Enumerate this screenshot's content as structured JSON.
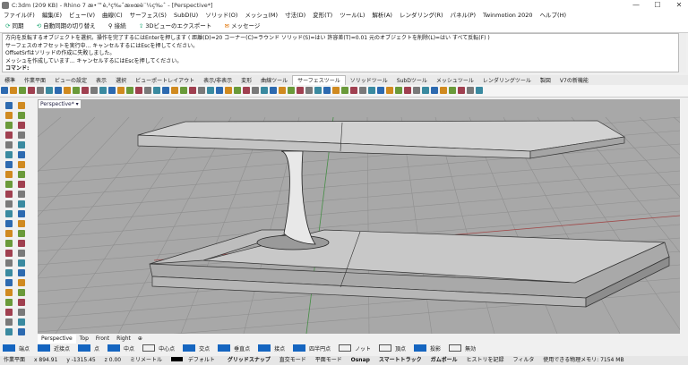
{
  "titlebar": {
    "title": "C:3dm (209 KB) - Rhino 7 æ•™è‚²ç‰ˆæ¤œè¨¼ç‰ˆ - [Perspective*]",
    "minimize": "—",
    "maximize": "☐",
    "close": "✕"
  },
  "menu": [
    "ファイル(F)",
    "編集(E)",
    "ビュー(V)",
    "曲線(C)",
    "サーフェス(S)",
    "SubD(U)",
    "ソリッド(O)",
    "メッシュ(M)",
    "寸法(D)",
    "変形(T)",
    "ツール(L)",
    "解析(A)",
    "レンダリング(R)",
    "パネル(P)",
    "Twinmotion 2020",
    "ヘルプ(H)"
  ],
  "commandbar": [
    {
      "icon": "sync-icon",
      "label": "同期"
    },
    {
      "icon": "auto-sync-icon",
      "label": "自動同期の切り替え"
    },
    {
      "icon": "link-icon",
      "label": "接続"
    },
    {
      "icon": "export-icon",
      "label": "3Dビューのエクスポート"
    },
    {
      "icon": "message-icon",
      "label": "メッセージ"
    }
  ],
  "history": [
    "方向を反転するオブジェクトを選択。操作を完了するにはEnterを押します ( 距離(D)=20  コーナー(C)=ラウンド  ソリッド(S)=はい  許容差(T)=0.01  元のオブジェクトを削除(L)=はい  すべて反転(F) )",
    "サーフェスのオフセットを実行中... キャンセルするにはEscを押してください。",
    "OffsetSrfはソリッドの作成に失敗しました。",
    "メッシュを作成しています... キャンセルするにはEscを押してください。",
    "コマンド:"
  ],
  "tabs": [
    "標準",
    "作業平面",
    "ビューの設定",
    "表示",
    "選択",
    "ビューポートレイアウト",
    "表示/非表示",
    "変形",
    "曲線ツール",
    "サーフェスツール",
    "ソリッドツール",
    "SubDツール",
    "メッシュツール",
    "レンダリングツール",
    "製図",
    "V7の新機能"
  ],
  "active_tab": "サーフェスツール",
  "viewport": {
    "title": "Perspective*",
    "menu_arrow": "▾"
  },
  "view_tabs": [
    "Perspective",
    "Top",
    "Front",
    "Right",
    "⊕"
  ],
  "snaps": [
    {
      "label": "端点",
      "checked": true
    },
    {
      "label": "近接点",
      "checked": true
    },
    {
      "label": "点",
      "checked": true
    },
    {
      "label": "中点",
      "checked": true
    },
    {
      "label": "中心点",
      "checked": false
    },
    {
      "label": "交点",
      "checked": true
    },
    {
      "label": "垂直点",
      "checked": true
    },
    {
      "label": "接点",
      "checked": true
    },
    {
      "label": "四半円点",
      "checked": true
    },
    {
      "label": "ノット",
      "checked": false
    },
    {
      "label": "頂点",
      "checked": false
    },
    {
      "label": "投影",
      "checked": true
    },
    {
      "label": "無効",
      "checked": false
    }
  ],
  "status": {
    "cplane": "作業平面",
    "x": "x 894.91",
    "y": "y -1315.45",
    "z": "z 0.00",
    "units": "ミリメートル",
    "layer": "デフォルト",
    "grid_snap": "グリッドスナップ",
    "ortho": "直交モード",
    "planar": "平面モード",
    "osnap": "Osnap",
    "smarttrack": "スマートトラック",
    "gumball": "ガムボール",
    "history": "ヒストリを記録",
    "filter": "フィルタ",
    "memory": "使用できる物理メモリ: 7154 MB"
  },
  "colors": {
    "viewport_bg": "#a8a8a8",
    "grid": "#8e8e8e",
    "x_axis": "#a04848",
    "y_axis": "#489048",
    "accent": "#1565c0"
  }
}
